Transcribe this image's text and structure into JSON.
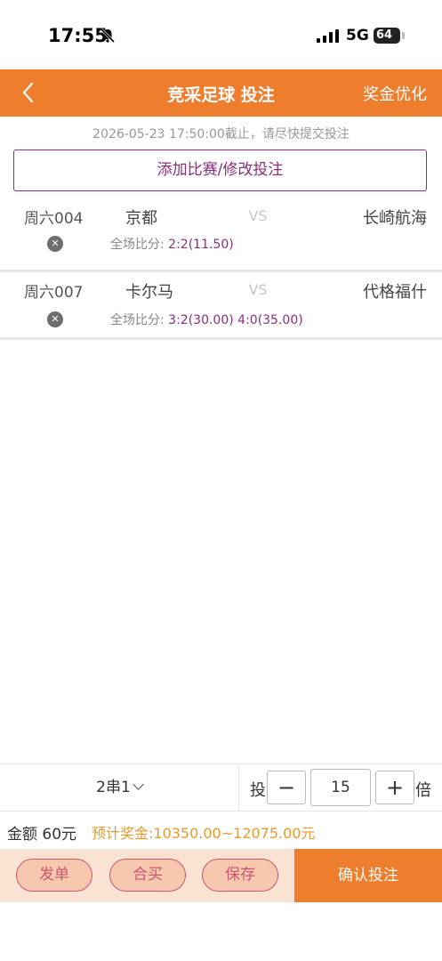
{
  "status_bar": {
    "time": "17:55",
    "network": "5G",
    "battery": "64"
  },
  "header": {
    "title": "竞采足球 投注",
    "right_action": "奖金优化"
  },
  "deadline_notice": "2026-05-23 17:50:00截止，请尽快提交投注",
  "add_match_label": "添加比赛/修改投注",
  "matches": [
    {
      "no": "周六004",
      "home": "京都",
      "vs": "VS",
      "away": "长崎航海",
      "bet_label": "全场比分:",
      "bet_odds": "2:2(11.50)"
    },
    {
      "no": "周六007",
      "home": "卡尔马",
      "vs": "VS",
      "away": "代格福什",
      "bet_label": "全场比分:",
      "bet_odds": "3:2(30.00) 4:0(35.00)"
    }
  ],
  "bet_bar": {
    "pass_type": "2串1",
    "tou_label": "投",
    "multiplier": "15",
    "bei_label": "倍"
  },
  "summary": {
    "amount": "金额 60元",
    "prize": "预计奖金:10350.00~12075.00元"
  },
  "actions": {
    "publish": "发单",
    "group_buy": "合买",
    "save": "保存",
    "confirm": "确认投注"
  },
  "colors": {
    "accent": "#ee7d2e",
    "purple": "#8a2f7a",
    "prize": "#e69a2d"
  }
}
